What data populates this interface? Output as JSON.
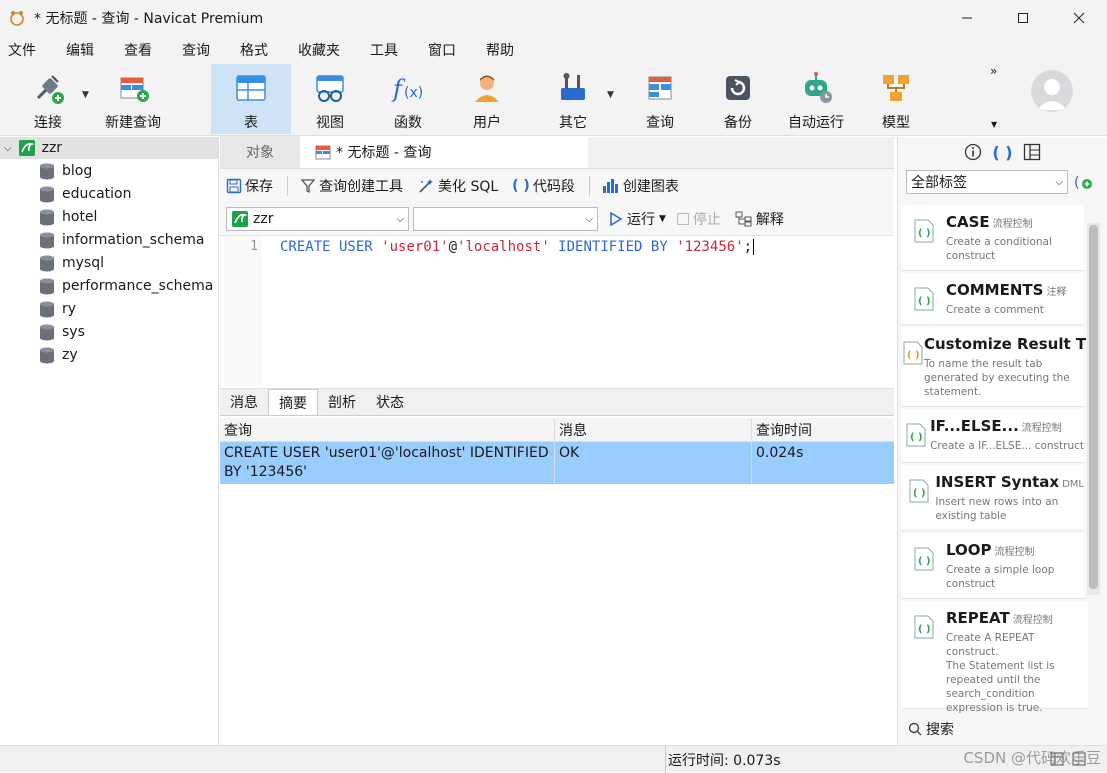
{
  "window": {
    "title": "* 无标题 - 查询 - Navicat Premium"
  },
  "menu": [
    "文件",
    "编辑",
    "查看",
    "查询",
    "格式",
    "收藏夹",
    "工具",
    "窗口",
    "帮助"
  ],
  "toolbar": {
    "connect": "连接",
    "new_query": "新建查询",
    "table": "表",
    "view": "视图",
    "function": "函数",
    "user": "用户",
    "other": "其它",
    "query": "查询",
    "backup": "备份",
    "auto_run": "自动运行",
    "model": "模型",
    "overflow": "»"
  },
  "sidebar": {
    "connection": "zzr",
    "databases": [
      "blog",
      "education",
      "hotel",
      "information_schema",
      "mysql",
      "performance_schema",
      "ry",
      "sys",
      "zy"
    ]
  },
  "tabs": {
    "objects": "对象",
    "query_tab": "* 无标题 - 查询"
  },
  "query_toolbar": {
    "save": "保存",
    "builder": "查询创建工具",
    "beautify": "美化 SQL",
    "snippet": "代码段",
    "chart": "创建图表"
  },
  "selectors": {
    "connection": "zzr",
    "database": ""
  },
  "run_controls": {
    "run": "运行",
    "stop": "停止",
    "explain": "解释"
  },
  "editor": {
    "line_number": "1",
    "tokens": {
      "t1": "CREATE USER ",
      "t2": "'user01'",
      "t3": "@",
      "t4": "'localhost'",
      "t5": " IDENTIFIED BY ",
      "t6": "'123456'",
      "t7": ";"
    }
  },
  "result_tabs": [
    "消息",
    "摘要",
    "剖析",
    "状态"
  ],
  "result_grid": {
    "headers": [
      "查询",
      "消息",
      "查询时间"
    ],
    "rows": [
      {
        "query_line1": "CREATE USER 'user01'@'localhost' IDENTIFIED",
        "query_line2": "BY '123456'",
        "message": "OK",
        "time": "0.024s"
      }
    ]
  },
  "status": {
    "run_time": "运行时间: 0.073s"
  },
  "snippets_panel": {
    "filter": "全部标签",
    "search_label": "搜索",
    "items": [
      {
        "name": "CASE",
        "category": "流程控制",
        "desc1": "Create a conditional",
        "desc2": "construct",
        "desc3": "",
        "desc4": "",
        "desc5": ""
      },
      {
        "name": "COMMENTS",
        "category": "注释",
        "desc1": "Create a comment",
        "desc2": "",
        "desc3": "",
        "desc4": "",
        "desc5": ""
      },
      {
        "name": "Customize Result T",
        "category": "",
        "desc1": "To name the result tab",
        "desc2": "generated by executing the",
        "desc3": "statement.",
        "desc4": "",
        "desc5": ""
      },
      {
        "name": "IF...ELSE...",
        "category": "流程控制",
        "desc1": "Create a IF...ELSE... construct",
        "desc2": "",
        "desc3": "",
        "desc4": "",
        "desc5": ""
      },
      {
        "name": "INSERT Syntax",
        "category": "DML",
        "desc1": "Insert new rows into an",
        "desc2": "existing table",
        "desc3": "",
        "desc4": "",
        "desc5": ""
      },
      {
        "name": "LOOP",
        "category": "流程控制",
        "desc1": "Create a simple loop",
        "desc2": "construct",
        "desc3": "",
        "desc4": "",
        "desc5": ""
      },
      {
        "name": "REPEAT",
        "category": "流程控制",
        "desc1": "Create A REPEAT construct.",
        "desc2": "The Statement list is",
        "desc3": "repeated until the",
        "desc4": "search_condition",
        "desc5": "expression is true."
      }
    ]
  },
  "watermark": "CSDN @代码欢乐豆",
  "colors": {
    "accent": "#2a6ad1",
    "string": "#c8283c",
    "selection": "#99ccff",
    "active_tool": "#cfe3f7"
  }
}
